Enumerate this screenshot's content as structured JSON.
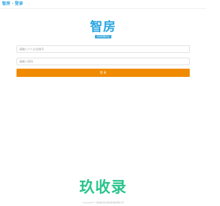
{
  "header": {
    "title": "智房 · 登录"
  },
  "brand": {
    "logo_text": "智房",
    "tag": "智房管理平台"
  },
  "login_form": {
    "username_placeholder": "请输入个人企业账号",
    "password_placeholder": "请输入密码",
    "submit_label": "登 录"
  },
  "footer": {
    "watermark_text": "玖收录",
    "copyright": "Copyright © 智房网 杭州智房科技有限公司"
  },
  "colors": {
    "brand_blue": "#2aa6e0",
    "submit_orange": "#f08a00",
    "watermark_green": "#29c48c"
  }
}
